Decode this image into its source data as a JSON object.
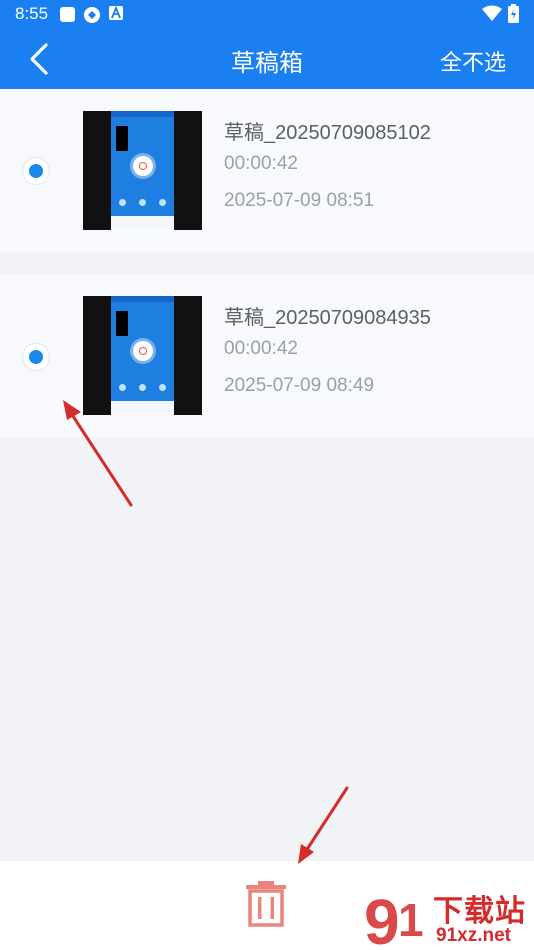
{
  "status": {
    "time": "8:55"
  },
  "header": {
    "title": "草稿箱",
    "deselect_label": "全不选"
  },
  "drafts": [
    {
      "name": "草稿_20250709085102",
      "duration": "00:00:42",
      "date": "2025-07-09 08:51",
      "selected": true
    },
    {
      "name": "草稿_20250709084935",
      "duration": "00:00:42",
      "date": "2025-07-09 08:49",
      "selected": true
    }
  ],
  "watermark": {
    "brand": "下载站",
    "url": "91xz.net"
  },
  "colors": {
    "accent": "#1a7ff0",
    "radio": "#1a8ae8",
    "delete": "#e8857d",
    "annotation": "#d42b2b"
  },
  "icons": {
    "back": "chevron-left-icon",
    "delete": "trash-icon"
  }
}
